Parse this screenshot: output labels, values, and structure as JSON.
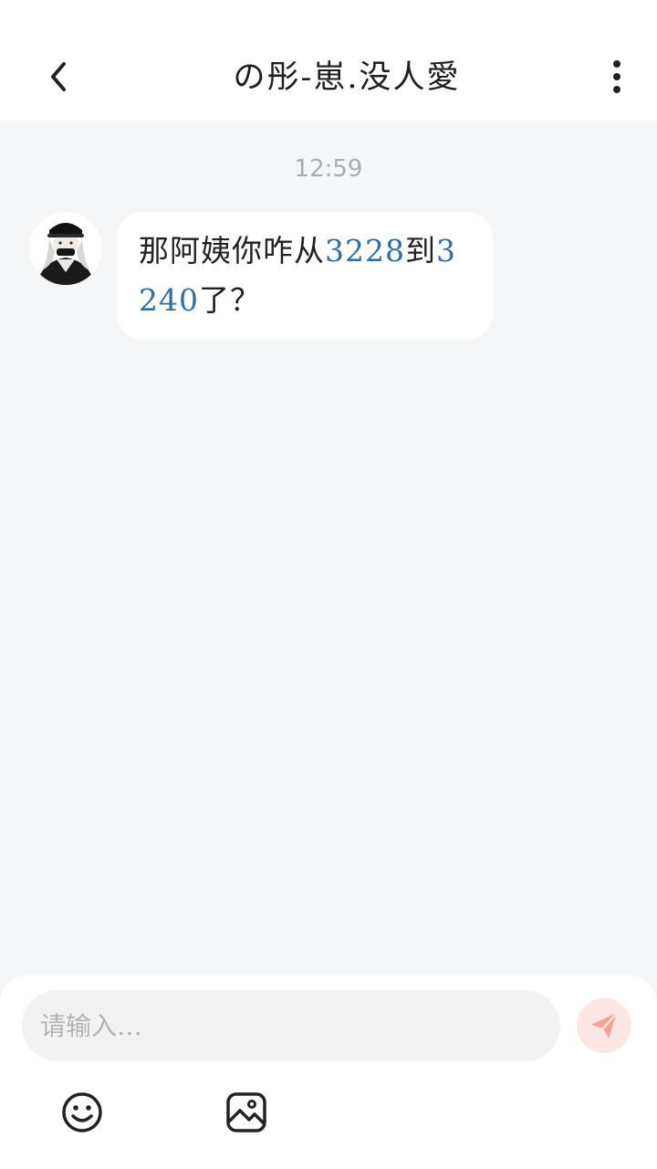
{
  "header": {
    "title": "の彤-崽.没人愛",
    "back_icon": "chevron-left-icon",
    "more_icon": "more-vertical-icon"
  },
  "chat": {
    "timestamp": "12:59",
    "messages": [
      {
        "sender": "other",
        "avatar": "avatar-anime-character",
        "parts": [
          {
            "text": "那阿姨你咋从",
            "type": "text"
          },
          {
            "text": "3228",
            "type": "number"
          },
          {
            "text": "到",
            "type": "text"
          },
          {
            "text": "3240",
            "type": "number"
          },
          {
            "text": "了？",
            "type": "text"
          }
        ]
      }
    ]
  },
  "composer": {
    "placeholder": "请输入…",
    "value": "",
    "send_icon": "send-icon",
    "emoji_icon": "emoji-icon",
    "image_icon": "image-icon"
  },
  "colors": {
    "background": "#f5f6f8",
    "bubble": "#ffffff",
    "number_link": "#2f6fa6",
    "send_button": "#fde7e4",
    "send_icon": "#f4a094"
  }
}
